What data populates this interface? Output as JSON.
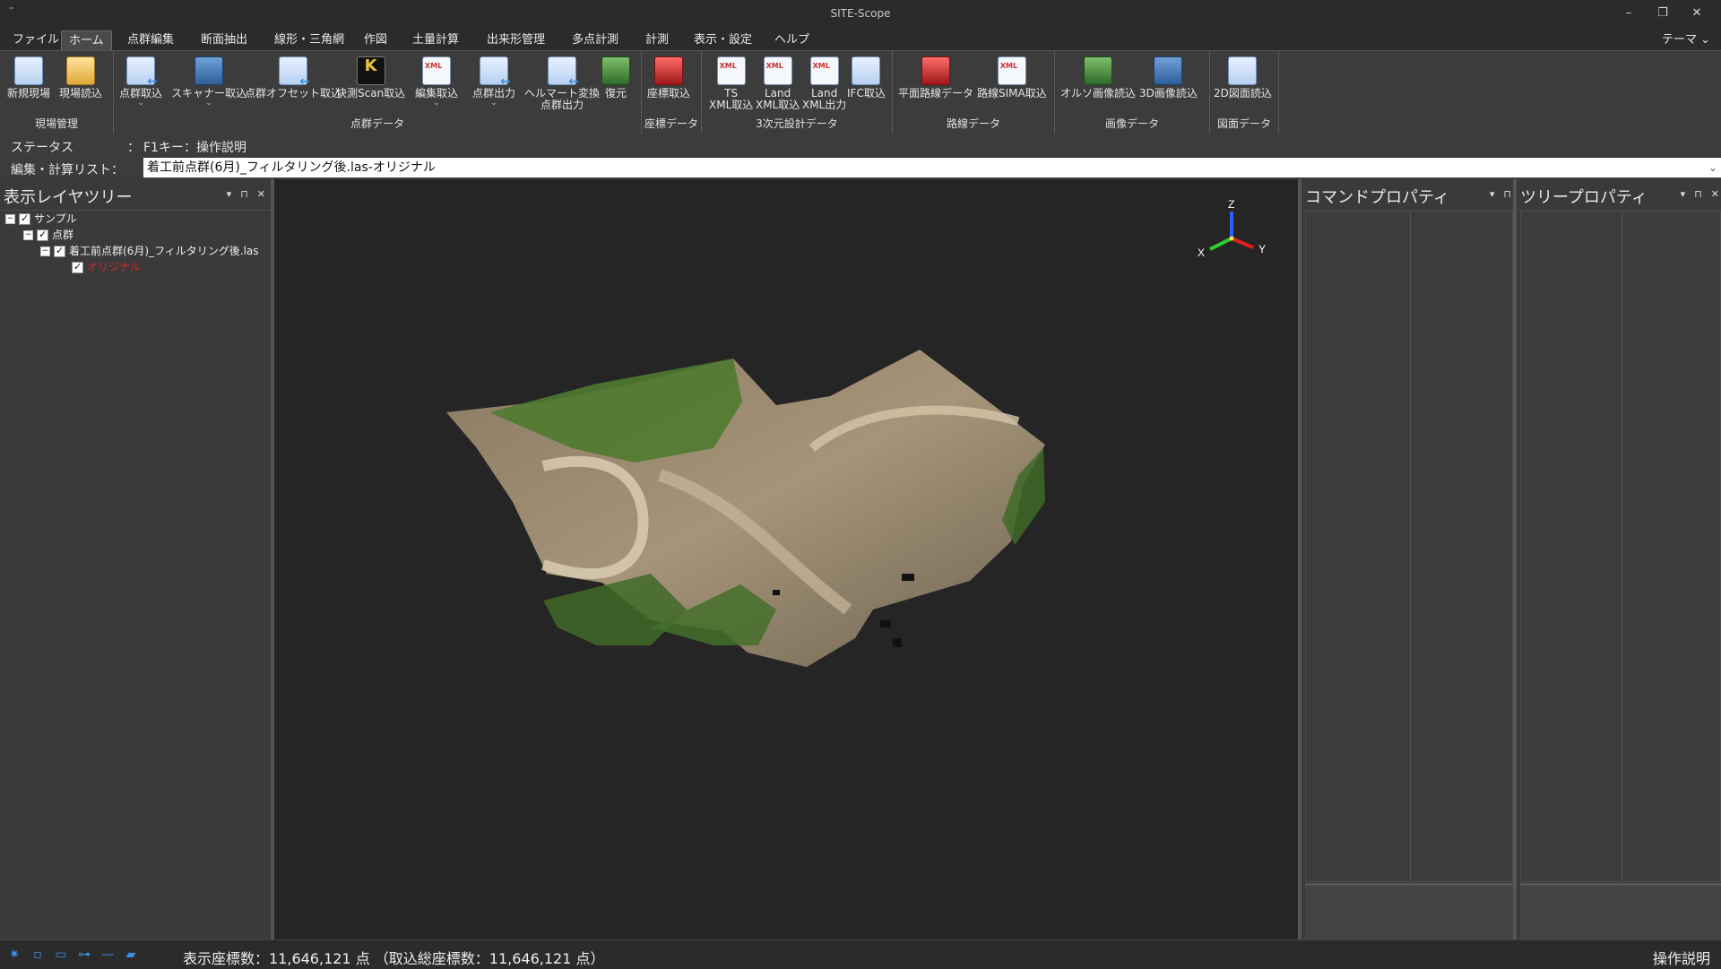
{
  "window": {
    "title": "SITE-Scope",
    "minimize": "–",
    "restore": "❐",
    "close": "✕"
  },
  "menu": {
    "items": [
      "ファイル",
      "ホーム",
      "点群編集",
      "断面抽出",
      "線形・三角網",
      "作図",
      "土量計算",
      "出来形管理",
      "多点計測",
      "計測",
      "表示・設定",
      "ヘルプ"
    ],
    "active_index": 1,
    "theme": "テーマ ⌄"
  },
  "ribbon": {
    "groups": [
      {
        "label": "現場管理",
        "buttons": [
          {
            "label": "新規現場",
            "icon": "new-site-icon"
          },
          {
            "label": "現場読込",
            "icon": "folder-icon"
          }
        ]
      },
      {
        "label": "点群データ",
        "buttons": [
          {
            "label": "点群取込",
            "icon": "pointcloud-import-icon",
            "caret": "⌄"
          },
          {
            "label": "スキャナー取込",
            "icon": "scanner-icon",
            "caret": "⌄"
          },
          {
            "label": "点群オフセット取込",
            "icon": "offset-import-icon"
          },
          {
            "label": "快測Scan取込",
            "icon": "kaisoku-scan-icon"
          },
          {
            "label": "編集取込",
            "icon": "edit-import-icon",
            "caret": "⌄"
          },
          {
            "label": "点群出力",
            "icon": "pointcloud-export-icon",
            "caret": "⌄"
          },
          {
            "label": "ヘルマート変換\n点群出力",
            "icon": "helmert-icon"
          },
          {
            "label": "復元",
            "icon": "restore-icon"
          }
        ]
      },
      {
        "label": "座標データ",
        "buttons": [
          {
            "label": "座標取込",
            "icon": "coordinate-import-icon"
          }
        ]
      },
      {
        "label": "3次元設計データ",
        "buttons": [
          {
            "label": "TS\nXML取込",
            "icon": "ts-xml-icon"
          },
          {
            "label": "Land\nXML取込",
            "icon": "landxml-import-icon"
          },
          {
            "label": "Land\nXML出力",
            "icon": "landxml-export-icon"
          },
          {
            "label": "IFC取込",
            "icon": "ifc-import-icon"
          }
        ]
      },
      {
        "label": "路線データ",
        "buttons": [
          {
            "label": "平面路線データ",
            "icon": "plane-route-icon"
          },
          {
            "label": "路線SIMA取込",
            "icon": "sima-import-icon"
          }
        ]
      },
      {
        "label": "画像データ",
        "buttons": [
          {
            "label": "オルソ画像読込",
            "icon": "ortho-image-icon"
          },
          {
            "label": "3D画像読込",
            "icon": "3d-image-icon"
          }
        ]
      },
      {
        "label": "図面データ",
        "buttons": [
          {
            "label": "2D図面読込",
            "icon": "2d-drawing-icon"
          }
        ]
      }
    ]
  },
  "status": {
    "label": "ステータス",
    "colon": "：",
    "value": "F1キー：操作説明"
  },
  "edit_list": {
    "label": "編集・計算リスト：",
    "value": "着工前点群(6月)_フィルタリング後.las-オリジナル",
    "dropdown": "⌄"
  },
  "layer_tree": {
    "title": "表示レイヤツリー",
    "ctrls": [
      "▾",
      "⊓",
      "✕"
    ],
    "nodes": [
      {
        "label": "サンプル",
        "twisty": "−"
      },
      {
        "label": "点群",
        "twisty": "−"
      },
      {
        "label": "着工前点群(6月)_フィルタリング後.las",
        "twisty": "−"
      },
      {
        "label": "オリジナル"
      }
    ]
  },
  "axis": {
    "z": "Z",
    "x": "X",
    "y": "Y"
  },
  "command_props": {
    "title": "コマンドプロパティ",
    "ctrls": [
      "▾",
      "⊓"
    ]
  },
  "tree_props": {
    "title": "ツリープロパティ",
    "ctrls": [
      "▾",
      "⊓",
      "✕"
    ]
  },
  "bottom": {
    "count_text": "表示座標数：11,646,121 点 （取込総座標数：11,646,121 点）",
    "help": "操作説明",
    "tools": [
      {
        "name": "settings-tool-icon",
        "glyph": "✷"
      },
      {
        "name": "point-tool-icon",
        "glyph": "▫"
      },
      {
        "name": "rect-tool-icon",
        "glyph": "▭"
      },
      {
        "name": "line-tool-icon",
        "glyph": "⊶"
      },
      {
        "name": "segment-tool-icon",
        "glyph": "—"
      },
      {
        "name": "plane-tool-icon",
        "glyph": "▰"
      }
    ]
  },
  "colors": {
    "accent": "#3d8fe0",
    "background": "#2b2b2b",
    "viewport": "#252525"
  }
}
